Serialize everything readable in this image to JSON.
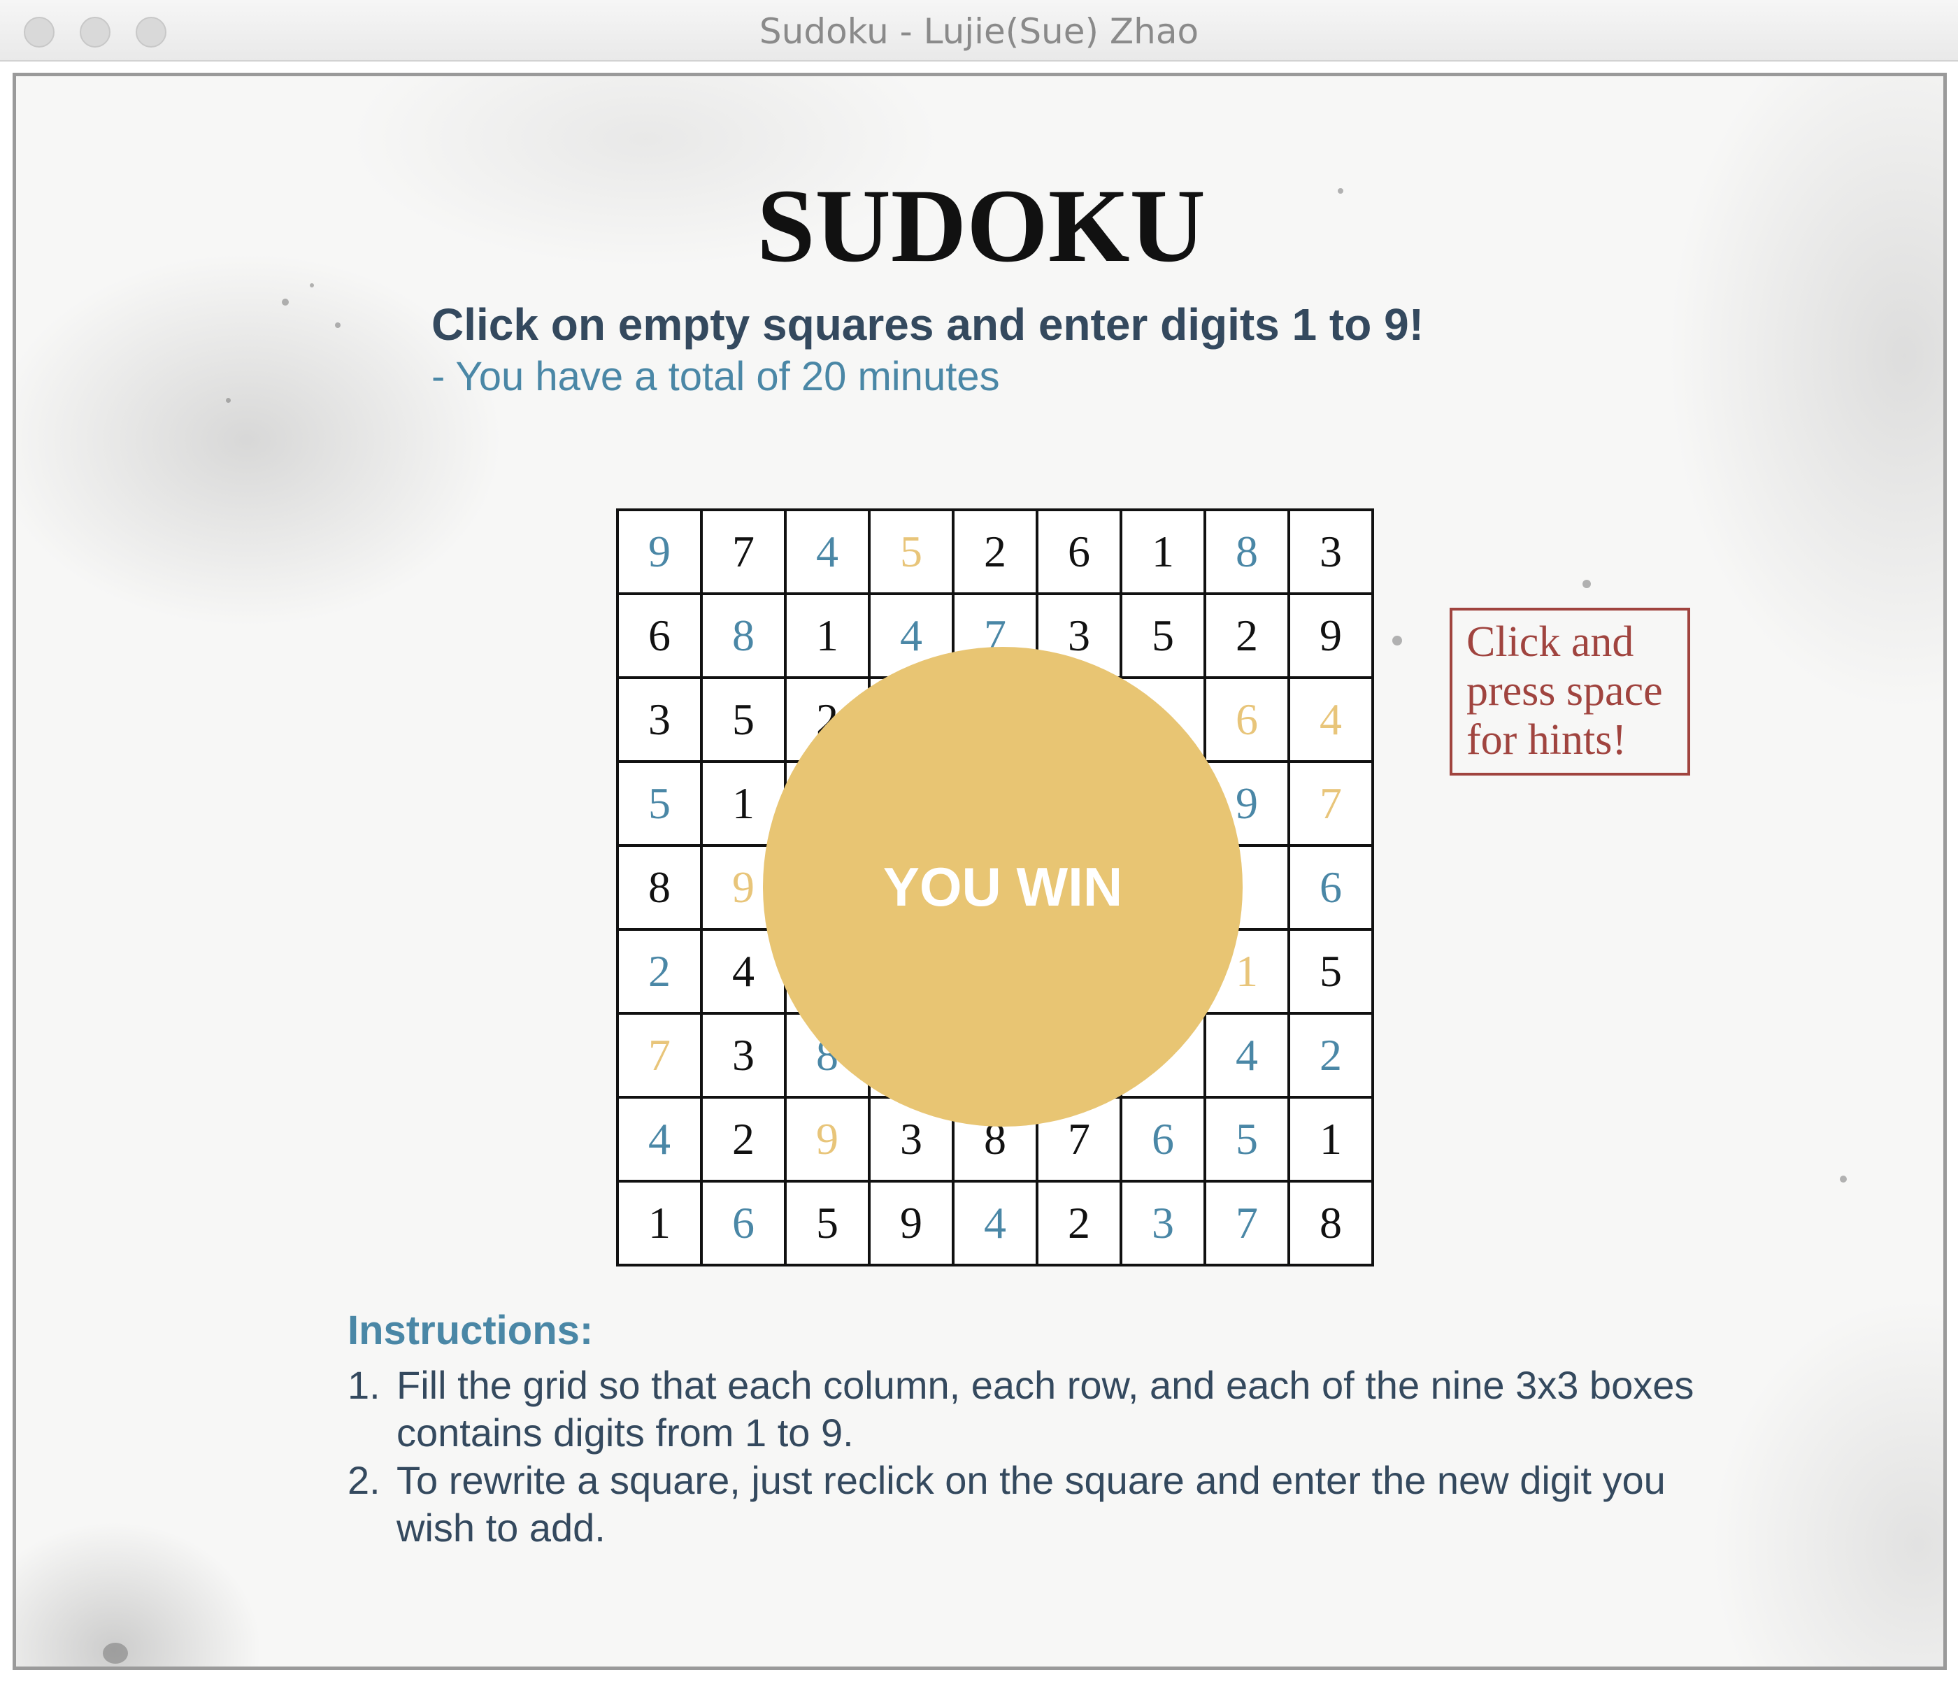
{
  "window": {
    "title": "Sudoku - Lujie(Sue) Zhao"
  },
  "header": {
    "title": "SUDOKU",
    "subtitle": "Click on empty squares and enter digits 1 to 9!",
    "time_note": "- You have a total of 20 minutes"
  },
  "board": {
    "rows": [
      [
        {
          "v": "9",
          "c": "blue"
        },
        {
          "v": "7",
          "c": "black"
        },
        {
          "v": "4",
          "c": "blue"
        },
        {
          "v": "5",
          "c": "gold"
        },
        {
          "v": "2",
          "c": "black"
        },
        {
          "v": "6",
          "c": "black"
        },
        {
          "v": "1",
          "c": "black"
        },
        {
          "v": "8",
          "c": "blue"
        },
        {
          "v": "3",
          "c": "black"
        }
      ],
      [
        {
          "v": "6",
          "c": "black"
        },
        {
          "v": "8",
          "c": "blue"
        },
        {
          "v": "1",
          "c": "black"
        },
        {
          "v": "4",
          "c": "blue"
        },
        {
          "v": "7",
          "c": "blue"
        },
        {
          "v": "3",
          "c": "black"
        },
        {
          "v": "5",
          "c": "black"
        },
        {
          "v": "2",
          "c": "black"
        },
        {
          "v": "9",
          "c": "black"
        }
      ],
      [
        {
          "v": "3",
          "c": "black"
        },
        {
          "v": "5",
          "c": "black"
        },
        {
          "v": "2",
          "c": "black"
        },
        {
          "v": "",
          "c": "black"
        },
        {
          "v": "",
          "c": "black"
        },
        {
          "v": "",
          "c": "black"
        },
        {
          "v": "",
          "c": "black"
        },
        {
          "v": "6",
          "c": "gold"
        },
        {
          "v": "4",
          "c": "gold"
        }
      ],
      [
        {
          "v": "5",
          "c": "blue"
        },
        {
          "v": "1",
          "c": "black"
        },
        {
          "v": "",
          "c": "black"
        },
        {
          "v": "",
          "c": "black"
        },
        {
          "v": "",
          "c": "black"
        },
        {
          "v": "",
          "c": "black"
        },
        {
          "v": "",
          "c": "black"
        },
        {
          "v": "9",
          "c": "blue"
        },
        {
          "v": "7",
          "c": "gold"
        }
      ],
      [
        {
          "v": "8",
          "c": "black"
        },
        {
          "v": "9",
          "c": "gold"
        },
        {
          "v": "",
          "c": "black"
        },
        {
          "v": "",
          "c": "black"
        },
        {
          "v": "",
          "c": "black"
        },
        {
          "v": "",
          "c": "black"
        },
        {
          "v": "",
          "c": "black"
        },
        {
          "v": "",
          "c": "black"
        },
        {
          "v": "6",
          "c": "blue"
        }
      ],
      [
        {
          "v": "2",
          "c": "blue"
        },
        {
          "v": "4",
          "c": "black"
        },
        {
          "v": "",
          "c": "black"
        },
        {
          "v": "",
          "c": "black"
        },
        {
          "v": "",
          "c": "black"
        },
        {
          "v": "",
          "c": "black"
        },
        {
          "v": "",
          "c": "black"
        },
        {
          "v": "1",
          "c": "gold"
        },
        {
          "v": "5",
          "c": "black"
        }
      ],
      [
        {
          "v": "7",
          "c": "gold"
        },
        {
          "v": "3",
          "c": "black"
        },
        {
          "v": "8",
          "c": "blue"
        },
        {
          "v": "",
          "c": "black"
        },
        {
          "v": "",
          "c": "black"
        },
        {
          "v": "",
          "c": "black"
        },
        {
          "v": "",
          "c": "black"
        },
        {
          "v": "4",
          "c": "blue"
        },
        {
          "v": "2",
          "c": "blue"
        }
      ],
      [
        {
          "v": "4",
          "c": "blue"
        },
        {
          "v": "2",
          "c": "black"
        },
        {
          "v": "9",
          "c": "gold"
        },
        {
          "v": "3",
          "c": "black"
        },
        {
          "v": "8",
          "c": "black"
        },
        {
          "v": "7",
          "c": "black"
        },
        {
          "v": "6",
          "c": "blue"
        },
        {
          "v": "5",
          "c": "blue"
        },
        {
          "v": "1",
          "c": "black"
        }
      ],
      [
        {
          "v": "1",
          "c": "black"
        },
        {
          "v": "6",
          "c": "blue"
        },
        {
          "v": "5",
          "c": "black"
        },
        {
          "v": "9",
          "c": "black"
        },
        {
          "v": "4",
          "c": "blue"
        },
        {
          "v": "2",
          "c": "black"
        },
        {
          "v": "3",
          "c": "blue"
        },
        {
          "v": "7",
          "c": "blue"
        },
        {
          "v": "8",
          "c": "black"
        }
      ]
    ]
  },
  "overlay": {
    "win_text": "YOU WIN"
  },
  "hint": {
    "text": "Click and press space for hints!"
  },
  "instructions": {
    "heading": "Instructions:",
    "items": [
      {
        "num": "1.",
        "text": "Fill the grid so that each column, each row, and each of the nine 3x3 boxes contains digits from 1 to 9."
      },
      {
        "num": "2.",
        "text": "To rewrite a square, just reclick on the square and enter the new digit you wish to add."
      }
    ]
  },
  "colors": {
    "given_digit": "#111111",
    "entered_digit": "#4a87a6",
    "hint_digit": "#e8c57a",
    "win_circle": "#e8c573",
    "hint_border": "#a0443f"
  }
}
